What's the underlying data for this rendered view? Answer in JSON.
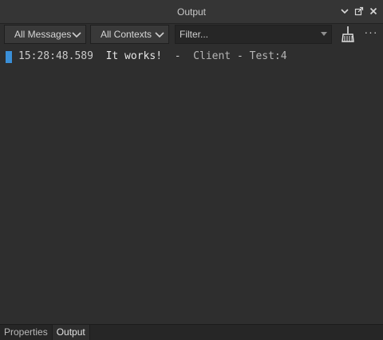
{
  "window": {
    "title": "Output",
    "actions": [
      {
        "icon": "chevron-down-icon"
      },
      {
        "icon": "undock-icon"
      },
      {
        "icon": "close-icon"
      }
    ]
  },
  "toolbar": {
    "messages_filter": "All Messages",
    "contexts_filter": "All Contexts",
    "filter_placeholder": "Filter...",
    "clear_icon": "broom-icon",
    "more_icon": "ellipsis-icon",
    "more_label": "···"
  },
  "log": [
    {
      "timestamp": "15:28:48.589",
      "message": "It works!",
      "separator": "-",
      "context": "Client",
      "source": "Test:4",
      "color": "#3a8fd8"
    }
  ],
  "tabs": [
    {
      "label": "Properties",
      "active": false
    },
    {
      "label": "Output",
      "active": true
    }
  ]
}
